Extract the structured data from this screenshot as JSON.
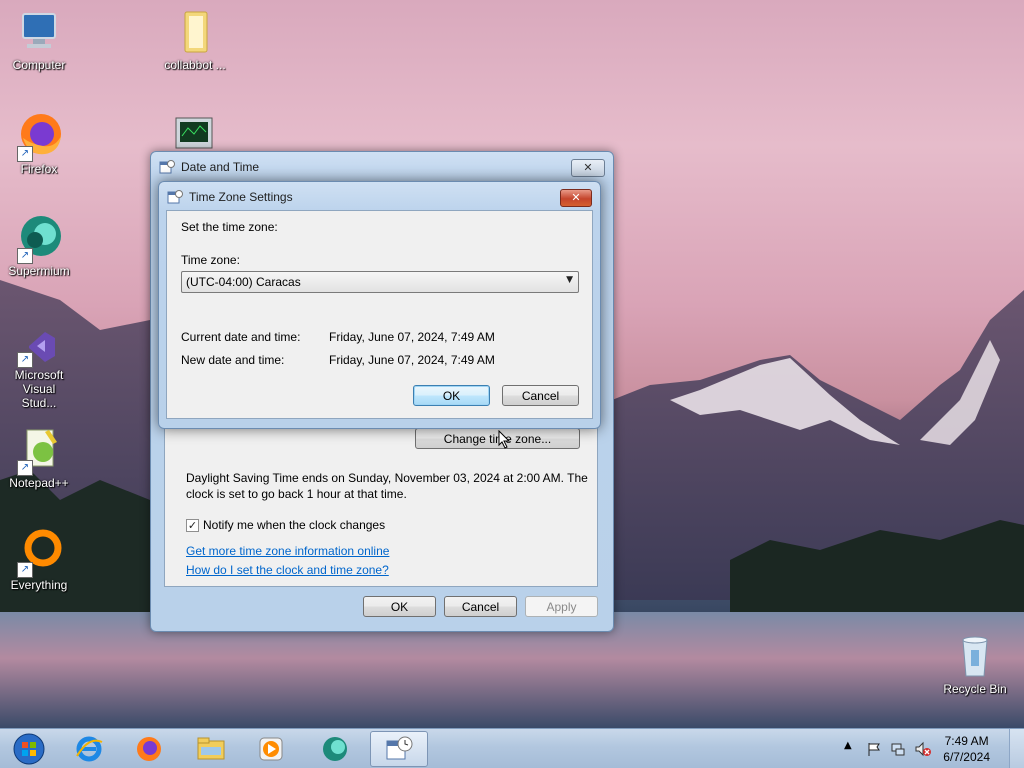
{
  "desktop": {
    "icons": [
      {
        "label": "Computer"
      },
      {
        "label": "collabbot ..."
      },
      {
        "label": "Firefox"
      },
      {
        "label": "Supermium"
      },
      {
        "label": "Microsoft Visual Stud..."
      },
      {
        "label": "Notepad++"
      },
      {
        "label": "Everything"
      },
      {
        "label": "Recycle Bin"
      }
    ]
  },
  "date_time_window": {
    "title": "Date and Time",
    "close_label": "✕",
    "change_tz_button": "Change time zone...",
    "dst_text_line1": "Daylight Saving Time ends on Sunday, November 03, 2024 at 2:00 AM. The",
    "dst_text_line2": "clock is set to go back 1 hour at that time.",
    "notify_label": "Notify me when the clock changes",
    "notify_checked": true,
    "link_more_info": "Get more time zone information online",
    "link_how_to": "How do I set the clock and time zone?",
    "ok": "OK",
    "cancel": "Cancel",
    "apply": "Apply"
  },
  "tz_dialog": {
    "title": "Time Zone Settings",
    "close_label": "✕",
    "instruction": "Set the time zone:",
    "tz_label": "Time zone:",
    "tz_value": "(UTC-04:00) Caracas",
    "current_label": "Current date and time:",
    "current_value": "Friday, June 07, 2024, 7:49 AM",
    "new_label": "New date and time:",
    "new_value": "Friday, June 07, 2024, 7:49 AM",
    "ok": "OK",
    "cancel": "Cancel"
  },
  "taskbar": {
    "items": [
      {
        "icon": "start-orb-icon"
      },
      {
        "icon": "internet-explorer-icon"
      },
      {
        "icon": "firefox-icon"
      },
      {
        "icon": "file-explorer-icon"
      },
      {
        "icon": "media-player-icon"
      },
      {
        "icon": "supermium-icon"
      },
      {
        "icon": "date-time-control-panel-icon",
        "active": true
      }
    ],
    "tray_icons": [
      "show-hidden-icons-icon",
      "action-center-flag-icon",
      "network-icon",
      "volume-muted-icon"
    ],
    "clock_time": "7:49 AM",
    "clock_date": "6/7/2024"
  },
  "colors": {
    "link": "#0066cc",
    "title_close_red": "#c5452c",
    "window_frame": "#b9d1ea"
  }
}
